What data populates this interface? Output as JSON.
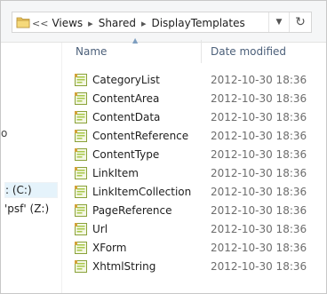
{
  "address_bar": {
    "overflow_chevron": "<<",
    "crumbs": [
      "Views",
      "Shared",
      "DisplayTemplates"
    ]
  },
  "nav": {
    "tiny_item": "o",
    "drive_c": ": (C:)",
    "drive_z": "'psf' (Z:)"
  },
  "columns": {
    "name": "Name",
    "date_modified": "Date modified"
  },
  "files": [
    {
      "name": "CategoryList",
      "date": "2012-10-30 18:36"
    },
    {
      "name": "ContentArea",
      "date": "2012-10-30 18:36"
    },
    {
      "name": "ContentData",
      "date": "2012-10-30 18:36"
    },
    {
      "name": "ContentReference",
      "date": "2012-10-30 18:36"
    },
    {
      "name": "ContentType",
      "date": "2012-10-30 18:36"
    },
    {
      "name": "LinkItem",
      "date": "2012-10-30 18:36"
    },
    {
      "name": "LinkItemCollection",
      "date": "2012-10-30 18:36"
    },
    {
      "name": "PageReference",
      "date": "2012-10-30 18:36"
    },
    {
      "name": "Url",
      "date": "2012-10-30 18:36"
    },
    {
      "name": "XForm",
      "date": "2012-10-30 18:36"
    },
    {
      "name": "XhtmlString",
      "date": "2012-10-30 18:36"
    }
  ],
  "icons": {
    "folder": "folder-icon",
    "file": "cshtml-file-icon",
    "refresh": "refresh-icon",
    "dropdown": "chevron-down-icon"
  },
  "colors": {
    "header_text": "#4c607a",
    "date_text": "#6d6d6d",
    "file_icon_green": "#a8c84a",
    "folder_yellow": "#e8c35a"
  }
}
